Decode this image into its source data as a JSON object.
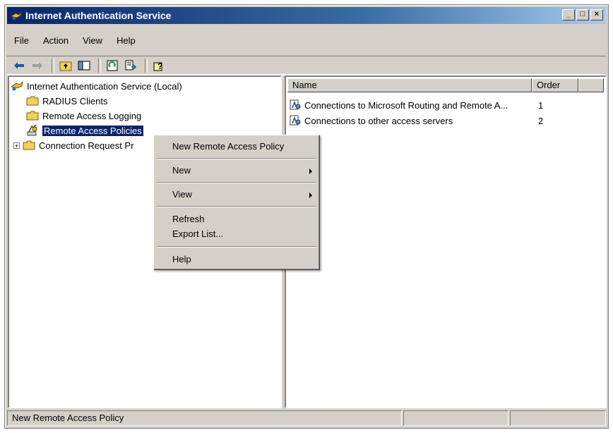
{
  "window": {
    "title": "Internet Authentication Service",
    "controls": [
      "_",
      "□",
      "×"
    ]
  },
  "menubar": [
    "File",
    "Action",
    "View",
    "Help"
  ],
  "toolbar": {
    "buttons": [
      "back-icon",
      "forward-icon",
      "up-folder-icon",
      "show-hide-tree-icon",
      "refresh-icon",
      "export-list-icon",
      "help-icon"
    ]
  },
  "tree": {
    "root": "Internet Authentication Service (Local)",
    "items": [
      {
        "label": "RADIUS Clients"
      },
      {
        "label": "Remote Access Logging"
      },
      {
        "label": "Remote Access Policies",
        "selected": true
      },
      {
        "label": "Connection Request Pr",
        "expandable": true
      }
    ]
  },
  "list": {
    "columns": [
      "Name",
      "Order"
    ],
    "rows": [
      {
        "name": "Connections to Microsoft Routing and Remote A...",
        "order": "1"
      },
      {
        "name": "Connections to other access servers",
        "order": "2"
      }
    ]
  },
  "context_menu": {
    "items": [
      {
        "label": "New Remote Access Policy"
      },
      {
        "label": "New",
        "submenu": true
      },
      {
        "label": "View",
        "submenu": true
      },
      {
        "label": "Refresh"
      },
      {
        "label": "Export List..."
      },
      {
        "label": "Help"
      }
    ]
  },
  "statusbar": {
    "text": "New Remote Access Policy"
  },
  "colors": {
    "selection": "#0a246a",
    "face": "#d4d0c8"
  }
}
